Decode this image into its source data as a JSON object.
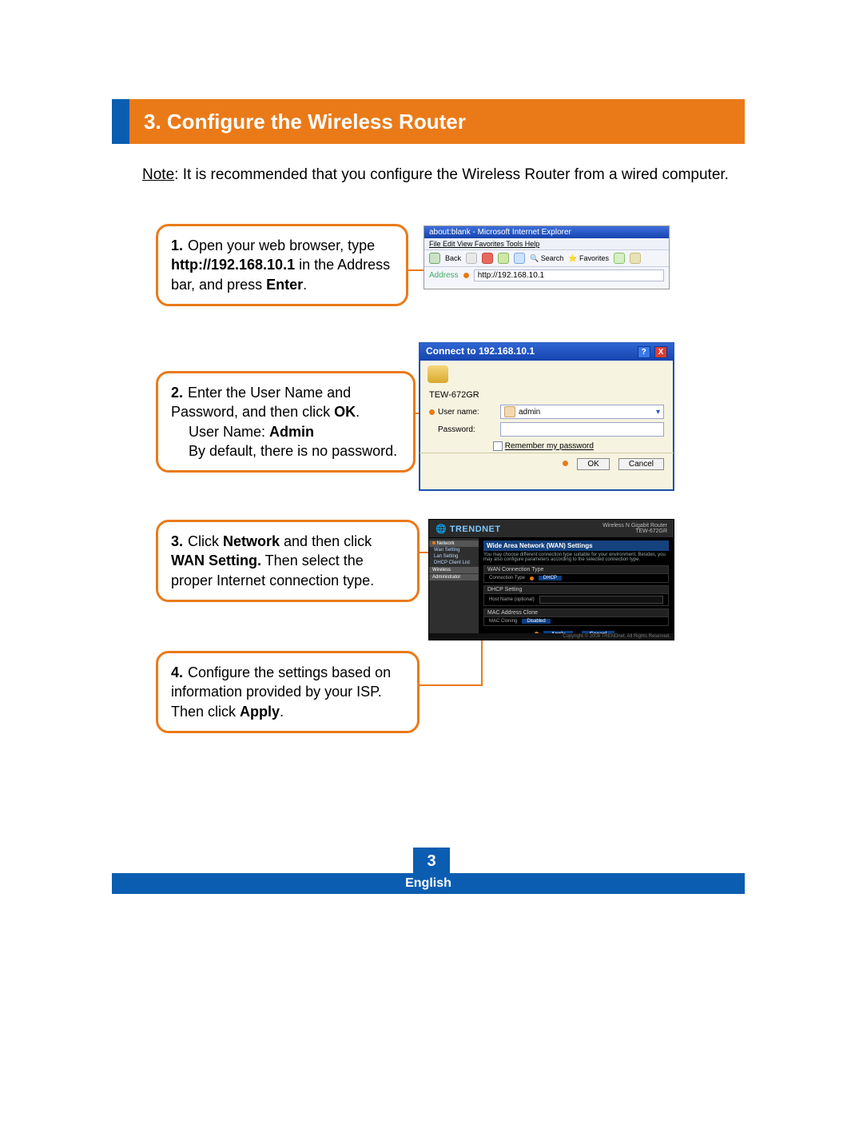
{
  "heading": "3. Configure the Wireless Router",
  "note_label": "Note",
  "note_text": ": It is recommended that you configure the Wireless Router from a wired computer.",
  "steps": {
    "s1": {
      "num": "1.",
      "text_a": "Open your web browser, type ",
      "bold_a": "http://192.168.10.1",
      "text_b": " in the Address bar, and press ",
      "bold_b": "Enter",
      "tail": "."
    },
    "s2": {
      "num": "2.",
      "text_a": "Enter the User Name and Password, and then click ",
      "bold_a": "OK",
      "tail_a": ".",
      "line_b_pre": "User Name: ",
      "bold_b": "Admin",
      "line_c": "By default, there is no password."
    },
    "s3": {
      "num": "3.",
      "text_a": "Click ",
      "bold_a": "Network",
      "text_b": " and then click ",
      "bold_b": "WAN Setting.",
      "text_c": " Then select the proper Internet connection type."
    },
    "s4": {
      "num": "4.",
      "text_a": "Configure the settings based on information provided by your ISP. Then click ",
      "bold_a": "Apply",
      "tail": "."
    }
  },
  "ie": {
    "title": "about:blank - Microsoft Internet Explorer",
    "menu": "File  Edit  View  Favorites  Tools  Help",
    "back": "Back",
    "search": "Search",
    "favorites": "Favorites",
    "addr_label": "Address",
    "url": "http://192.168.10.1"
  },
  "login": {
    "title": "Connect to 192.168.10.1",
    "help": "?",
    "close": "X",
    "realm": "TEW-672GR",
    "user_label": "User name:",
    "user_value": "admin",
    "pass_label": "Password:",
    "remember": "Remember my password",
    "ok": "OK",
    "cancel": "Cancel"
  },
  "router": {
    "brand": "TRENDNET",
    "model_line1": "Wireless N Gigabit Router",
    "model_line2": "TEW-672GR",
    "sidebar": {
      "cat1": "Network",
      "i1": "Wan Setting",
      "i2": "Lan Setting",
      "i3": "DHCP Client List",
      "cat2": "Wireless",
      "cat3": "Administrator"
    },
    "page_title": "Wide Area Network (WAN) Settings",
    "page_desc": "You may choose different connection type suitable for your environment. Besides, you may also configure parameters according to the selected connection type.",
    "sect1": "WAN Connection Type",
    "conn_type_label": "Connection Type",
    "conn_type_value": "DHCP",
    "sect2": "DHCP Setting",
    "hostname_label": "Host Name (optional)",
    "sect3": "MAC Address Clone",
    "mac_label": "MAC Cloning",
    "mac_value": "Disabled",
    "apply": "Apply",
    "cancel": "Cancel",
    "copyright": "Copyright © 2008 TRENDnet. All Rights Reserved."
  },
  "page_number": "3",
  "language": "English"
}
